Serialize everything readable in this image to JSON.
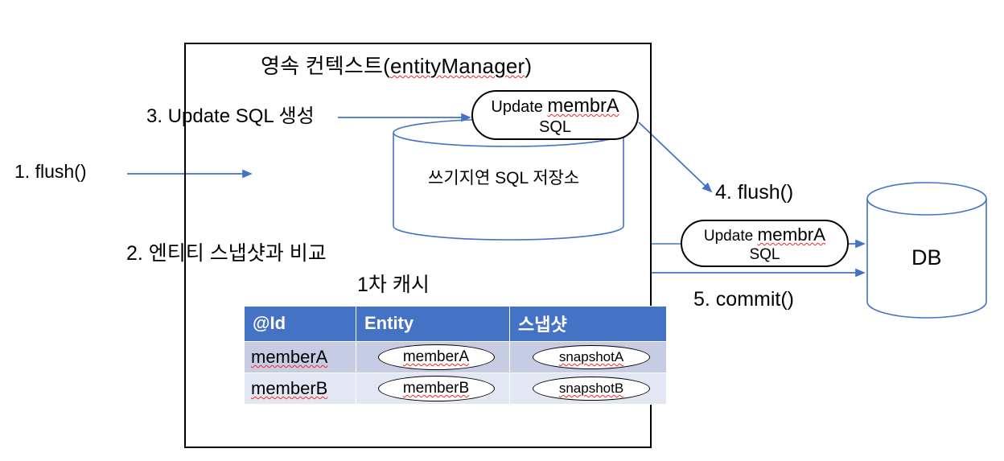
{
  "diagram": {
    "context_box": {
      "title_korean": "영속  컨텍스트(",
      "title_code": "entityManager",
      "title_close": ")"
    },
    "steps": {
      "step1": "1. flush()",
      "step2": "2. 엔티티 스냅샷과 비교",
      "step3": "3. Update SQL 생성",
      "step4": "4. flush()",
      "step5": "5. commit()"
    },
    "write_behind_store": {
      "label": "쓰기지연 SQL 저장소"
    },
    "sql_box_context": {
      "line1_prefix": "Update ",
      "line1_code": "membrA",
      "line2": "SQL"
    },
    "sql_box_db": {
      "line1_prefix": "Update ",
      "line1_code": "membrA",
      "line2": "SQL"
    },
    "database": {
      "label": "DB"
    },
    "first_level_cache": {
      "title": "1차 캐시",
      "columns": [
        "@Id",
        "Entity",
        "스냅샷"
      ],
      "rows": [
        {
          "id": "memberA",
          "entity": "memberA",
          "snapshot": "snapshotA"
        },
        {
          "id": "memberB",
          "entity": "memberB",
          "snapshot": "snapshotB"
        }
      ]
    },
    "colors": {
      "table_header": "#4472c4",
      "row_a": "#c6cce4",
      "row_b": "#e3e7f3",
      "arrow": "#4472c4",
      "shape_outline": "#4472c4",
      "box_outline": "#000000"
    }
  }
}
